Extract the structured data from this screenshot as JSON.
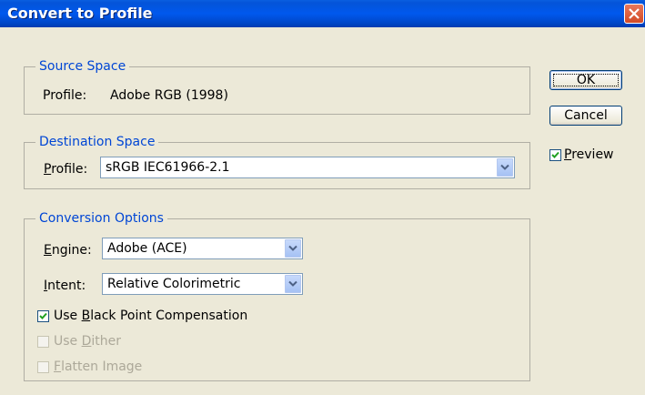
{
  "window": {
    "title": "Convert to Profile"
  },
  "source_space": {
    "legend": "Source Space",
    "profile_label": "Profile:",
    "profile_value": "Adobe RGB (1998)"
  },
  "destination_space": {
    "legend": "Destination Space",
    "profile_label_p": "P",
    "profile_label_rest": "rofile:",
    "profile_value": "sRGB IEC61966-2.1"
  },
  "conversion_options": {
    "legend": "Conversion Options",
    "engine_label_e": "E",
    "engine_label_rest": "ngine:",
    "engine_value": "Adobe (ACE)",
    "intent_label_i": "I",
    "intent_label_rest": "ntent:",
    "intent_value": "Relative Colorimetric",
    "bpc": {
      "pre": "Use ",
      "u": "B",
      "post": "lack Point Compensation",
      "checked": true
    },
    "dither": {
      "pre": "Use ",
      "u": "D",
      "post": "ither",
      "checked": false,
      "disabled": true
    },
    "flatten": {
      "pre": "",
      "u": "F",
      "post": "latten Image",
      "checked": false,
      "disabled": true
    }
  },
  "buttons": {
    "ok": "OK",
    "cancel": "Cancel"
  },
  "preview": {
    "u": "P",
    "post": "review",
    "checked": true
  }
}
